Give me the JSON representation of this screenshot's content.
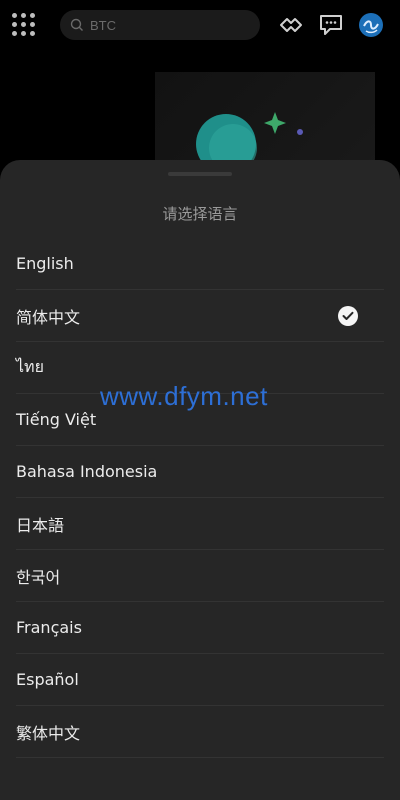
{
  "search": {
    "placeholder": "BTC"
  },
  "sheet": {
    "title": "请选择语言",
    "languages": [
      {
        "label": "English",
        "selected": false
      },
      {
        "label": "简体中文",
        "selected": true
      },
      {
        "label": "ไทย",
        "selected": false
      },
      {
        "label": "Tiếng Việt",
        "selected": false
      },
      {
        "label": "Bahasa Indonesia",
        "selected": false
      },
      {
        "label": "日本語",
        "selected": false
      },
      {
        "label": "한국어",
        "selected": false
      },
      {
        "label": "Français",
        "selected": false
      },
      {
        "label": "Español",
        "selected": false
      },
      {
        "label": "繁体中文",
        "selected": false
      }
    ]
  },
  "watermark": "www.dfym.net",
  "colors": {
    "sheet_background": "#262626",
    "watermark": "#2d6fd6",
    "accent_teal": "#1f8f8a",
    "accent_green": "#3ea86a"
  }
}
